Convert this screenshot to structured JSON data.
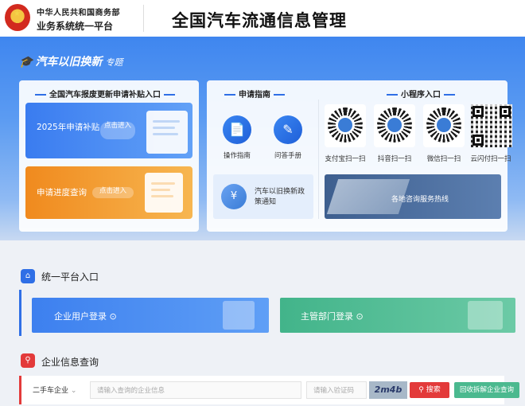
{
  "header": {
    "org": "中华人民共和国商务部",
    "system": "业务系统统一平台",
    "title": "全国汽车流通信息管理"
  },
  "banner": {
    "tag": "汽车以旧换新",
    "tag_sub": "专题"
  },
  "subsidy_panel": {
    "title": "全国汽车报废更新申请补贴入口",
    "apply_card": {
      "label": "2025年申请补贴",
      "button": "点击进入"
    },
    "progress_card": {
      "label": "申请进度查询",
      "button": "点击进入"
    }
  },
  "guide_panel": {
    "title": "申请指南",
    "items": [
      {
        "label": "操作指南"
      },
      {
        "label": "问答手册"
      }
    ],
    "notice": "汽车以旧换新政策通知"
  },
  "mini_panel": {
    "title": "小程序入口",
    "items": [
      {
        "label": "支付宝扫一扫"
      },
      {
        "label": "抖音扫一扫"
      },
      {
        "label": "微信扫一扫"
      },
      {
        "label": "云闪付扫一扫"
      }
    ],
    "hotline": "各地咨询服务热线"
  },
  "platform": {
    "title": "统一平台入口",
    "enterprise": "企业用户登录",
    "authority": "主管部门登录"
  },
  "query": {
    "title": "企业信息查询",
    "category": "二手车企业",
    "name_placeholder": "请输入查询的企业信息",
    "captcha_placeholder": "请输入验证码",
    "captcha_text": "2m4b",
    "search_button": "搜索",
    "dismantle_button": "回收拆解企业查询"
  },
  "colors": {
    "primary_blue": "#2f6fe6",
    "orange": "#f08a1e",
    "green": "#4bb98f",
    "red": "#e33a3a"
  }
}
